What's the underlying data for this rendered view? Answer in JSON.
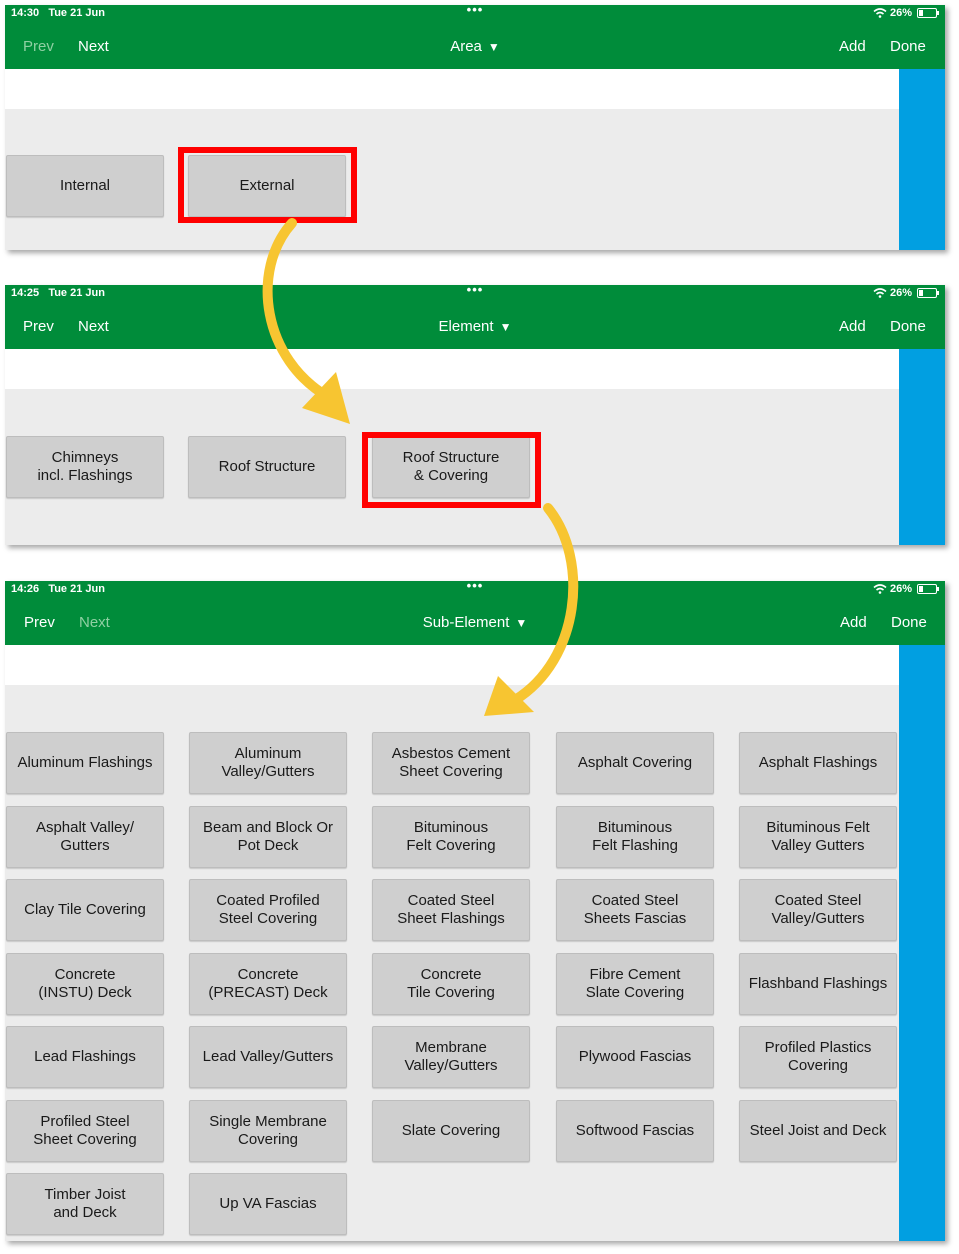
{
  "panels": [
    {
      "status": {
        "time": "14:30",
        "date": "Tue 21 Jun",
        "battery": "26%"
      },
      "nav": {
        "prev": "Prev",
        "next": "Next",
        "title": "Area",
        "caret": "▼",
        "add": "Add",
        "done": "Done"
      },
      "tiles": [
        "Internal",
        "External"
      ],
      "highlight_index": 1
    },
    {
      "status": {
        "time": "14:25",
        "date": "Tue 21 Jun",
        "battery": "26%"
      },
      "nav": {
        "prev": "Prev",
        "next": "Next",
        "title": "Element",
        "caret": "▼",
        "add": "Add",
        "done": "Done"
      },
      "tiles": [
        "Chimneys\nincl. Flashings",
        "Roof Structure",
        "Roof Structure\n& Covering"
      ],
      "highlight_index": 2
    },
    {
      "status": {
        "time": "14:26",
        "date": "Tue 21 Jun",
        "battery": "26%"
      },
      "nav": {
        "prev": "Prev",
        "next": "Next",
        "title": "Sub-Element",
        "caret": "▼",
        "add": "Add",
        "done": "Done"
      },
      "tiles": [
        "Aluminum Flashings",
        "Aluminum\nValley/Gutters",
        "Asbestos Cement\nSheet Covering",
        "Asphalt Covering",
        "Asphalt Flashings",
        "Asphalt Valley/\nGutters",
        "Beam and Block Or\nPot Deck",
        "Bituminous\nFelt Covering",
        "Bituminous\nFelt Flashing",
        "Bituminous Felt\nValley Gutters",
        "Clay Tile Covering",
        "Coated Profiled\nSteel Covering",
        "Coated Steel\nSheet Flashings",
        "Coated Steel\nSheets Fascias",
        "Coated Steel\nValley/Gutters",
        "Concrete\n(INSTU) Deck",
        "Concrete\n(PRECAST) Deck",
        "Concrete\nTile Covering",
        "Fibre Cement\nSlate Covering",
        "Flashband Flashings",
        "Lead Flashings",
        "Lead Valley/Gutters",
        "Membrane\nValley/Gutters",
        "Plywood Fascias",
        "Profiled Plastics\nCovering",
        "Profiled Steel\nSheet Covering",
        "Single Membrane\nCovering",
        "Slate Covering",
        "Softwood Fascias",
        "Steel Joist and Deck",
        "Timber Joist\nand Deck",
        "Up VA Fascias"
      ],
      "highlight_index": -1
    }
  ],
  "colors": {
    "green": "#008c3a",
    "blue": "#019fe1",
    "highlight": "#ff0000",
    "arrow": "#f7c531"
  }
}
